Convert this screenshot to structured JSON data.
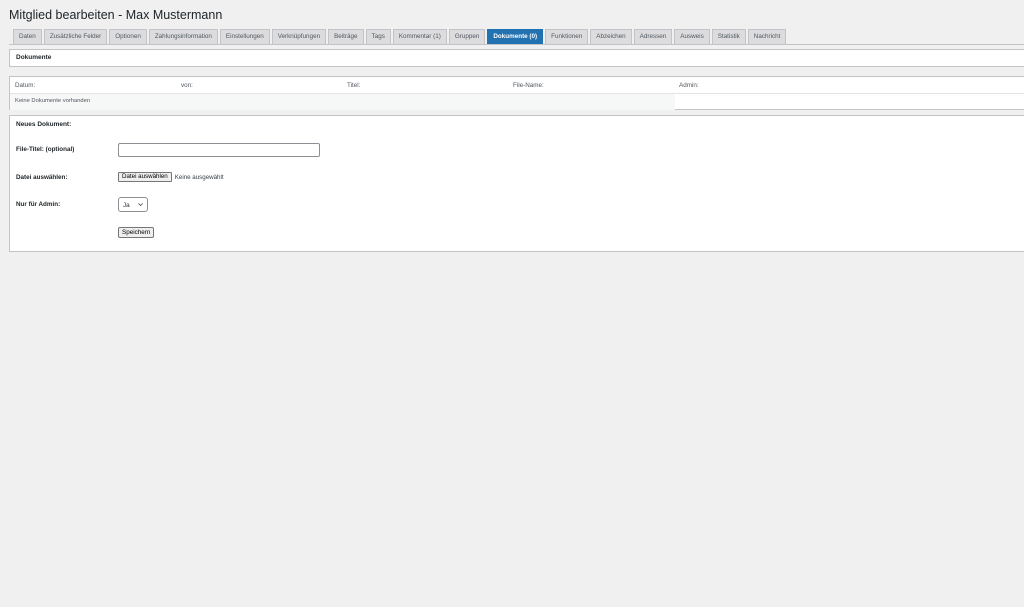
{
  "page": {
    "title": "Mitglied bearbeiten - Max Mustermann"
  },
  "tabs": [
    {
      "label": "Daten",
      "active": false
    },
    {
      "label": "Zusätzliche Felder",
      "active": false
    },
    {
      "label": "Optionen",
      "active": false
    },
    {
      "label": "Zahlungsinformation",
      "active": false
    },
    {
      "label": "Einstellungen",
      "active": false
    },
    {
      "label": "Verknüpfungen",
      "active": false
    },
    {
      "label": "Beiträge",
      "active": false
    },
    {
      "label": "Tags",
      "active": false
    },
    {
      "label": "Kommentar (1)",
      "active": false
    },
    {
      "label": "Gruppen",
      "active": false
    },
    {
      "label": "Dokumente (0)",
      "active": true
    },
    {
      "label": "Funktionen",
      "active": false
    },
    {
      "label": "Abzeichen",
      "active": false
    },
    {
      "label": "Adressen",
      "active": false
    },
    {
      "label": "Ausweis",
      "active": false
    },
    {
      "label": "Statistik",
      "active": false
    },
    {
      "label": "Nachricht",
      "active": false
    }
  ],
  "section": {
    "heading": "Dokumente"
  },
  "table": {
    "columns": [
      "Datum:",
      "von:",
      "Titel:",
      "File-Name:",
      "Admin:"
    ],
    "empty_message": "Keine Dokumente vorhanden"
  },
  "form": {
    "title": "Neues Dokument:",
    "file_title_label": "File-Titel: (optional)",
    "file_title_value": "",
    "file_select_label": "Datei auswählen:",
    "file_button_label": "Datei auswählen",
    "file_status": "Keine ausgewählt",
    "admin_only_label": "Nur für Admin:",
    "admin_only_value": "Ja",
    "save_label": "Speichern"
  },
  "colors": {
    "background": "#f0f0f1",
    "active_tab": "#2271b1",
    "inactive_tab": "#dcdcde",
    "panel": "#ffffff"
  },
  "icons": {
    "select_arrow": "chevron-down-icon"
  }
}
